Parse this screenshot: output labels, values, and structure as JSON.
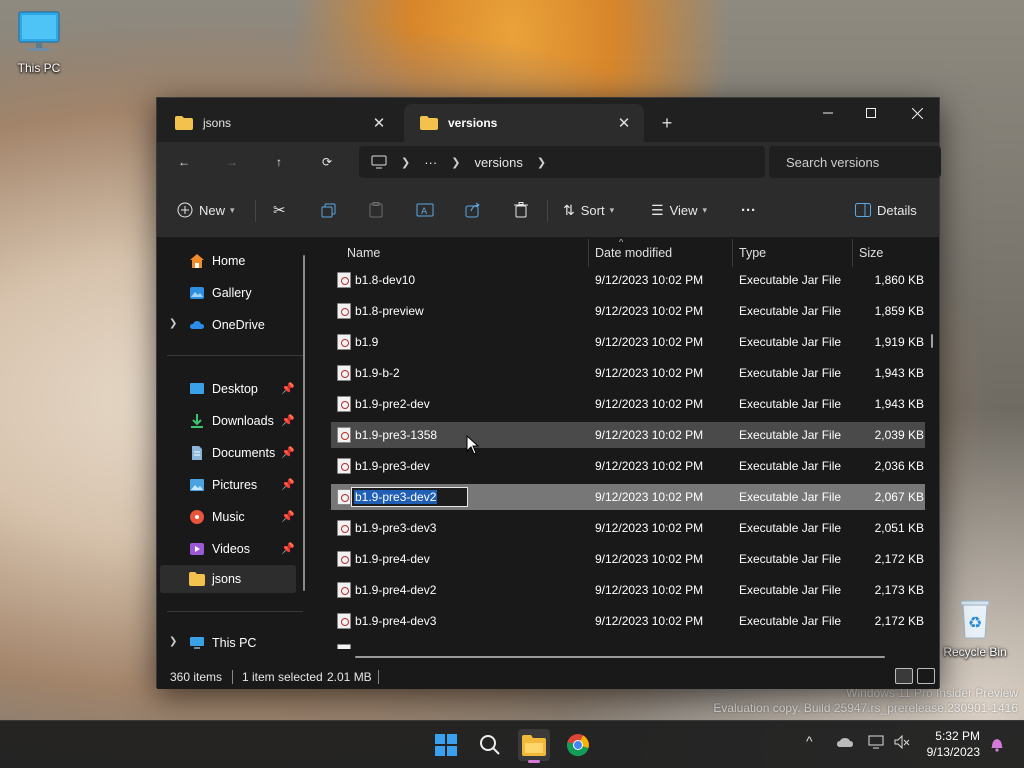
{
  "desktop": {
    "icons": [
      {
        "label": "This PC"
      },
      {
        "label": "Recycle Bin"
      }
    ],
    "watermark": {
      "line1": "Windows 11 Pro Insider Preview",
      "line2": "Evaluation copy. Build 25947.rs_prerelease.230901-1416"
    }
  },
  "window": {
    "tabs": [
      {
        "label": "jsons",
        "active": false
      },
      {
        "label": "versions",
        "active": true
      }
    ],
    "new_tab": "+",
    "controls": {
      "minimize": "—",
      "maximize": "☐",
      "close": "✕"
    }
  },
  "address": {
    "back": "←",
    "forward": "→",
    "up": "↑",
    "refresh": "⟳",
    "ellipsis": "···",
    "path_current": "versions",
    "search_placeholder": "Search versions"
  },
  "toolbar": {
    "new_label": "New",
    "sort_label": "Sort",
    "view_label": "View",
    "more": "···",
    "details_label": "Details"
  },
  "nav": {
    "items": [
      {
        "label": "Home",
        "icon": "home-icon"
      },
      {
        "label": "Gallery",
        "icon": "gallery-icon"
      },
      {
        "label": "OneDrive",
        "icon": "cloud-icon"
      },
      {
        "label": "Desktop",
        "icon": "desktop-icon"
      },
      {
        "label": "Downloads",
        "icon": "download-icon"
      },
      {
        "label": "Documents",
        "icon": "documents-icon"
      },
      {
        "label": "Pictures",
        "icon": "pictures-icon"
      },
      {
        "label": "Music",
        "icon": "music-icon"
      },
      {
        "label": "Videos",
        "icon": "videos-icon"
      },
      {
        "label": "jsons",
        "icon": "folder-icon"
      },
      {
        "label": "This PC",
        "icon": "computer-icon"
      }
    ]
  },
  "columns": {
    "name": "Name",
    "date": "Date modified",
    "type": "Type",
    "size": "Size"
  },
  "files": [
    {
      "name": "b1.8-dev10",
      "date": "9/12/2023 10:02 PM",
      "type": "Executable Jar File",
      "size": "1,860 KB"
    },
    {
      "name": "b1.8-preview",
      "date": "9/12/2023 10:02 PM",
      "type": "Executable Jar File",
      "size": "1,859 KB"
    },
    {
      "name": "b1.9",
      "date": "9/12/2023 10:02 PM",
      "type": "Executable Jar File",
      "size": "1,919 KB"
    },
    {
      "name": "b1.9-b-2",
      "date": "9/12/2023 10:02 PM",
      "type": "Executable Jar File",
      "size": "1,943 KB"
    },
    {
      "name": "b1.9-pre2-dev",
      "date": "9/12/2023 10:02 PM",
      "type": "Executable Jar File",
      "size": "1,943 KB"
    },
    {
      "name": "b1.9-pre3-1358",
      "date": "9/12/2023 10:02 PM",
      "type": "Executable Jar File",
      "size": "2,039 KB"
    },
    {
      "name": "b1.9-pre3-dev",
      "date": "9/12/2023 10:02 PM",
      "type": "Executable Jar File",
      "size": "2,036 KB"
    },
    {
      "name": "b1.9-pre3-dev2",
      "date": "9/12/2023 10:02 PM",
      "type": "Executable Jar File",
      "size": "2,067 KB"
    },
    {
      "name": "b1.9-pre3-dev3",
      "date": "9/12/2023 10:02 PM",
      "type": "Executable Jar File",
      "size": "2,051 KB"
    },
    {
      "name": "b1.9-pre4-dev",
      "date": "9/12/2023 10:02 PM",
      "type": "Executable Jar File",
      "size": "2,172 KB"
    },
    {
      "name": "b1.9-pre4-dev2",
      "date": "9/12/2023 10:02 PM",
      "type": "Executable Jar File",
      "size": "2,173 KB"
    },
    {
      "name": "b1.9-pre4-dev3",
      "date": "9/12/2023 10:02 PM",
      "type": "Executable Jar File",
      "size": "2,172 KB"
    }
  ],
  "rename_value": "b1.9-pre3-dev2",
  "status": {
    "count": "360 items",
    "selected": "1 item selected",
    "size": "2.01 MB"
  },
  "taskbar": {
    "time": "5:32 PM",
    "date": "9/13/2023",
    "chevron": "^"
  },
  "colors": {
    "window_bg": "#191919",
    "toolbar_bg": "#2c2c2c",
    "selection": "#777777",
    "accent": "#1f5fb5"
  }
}
